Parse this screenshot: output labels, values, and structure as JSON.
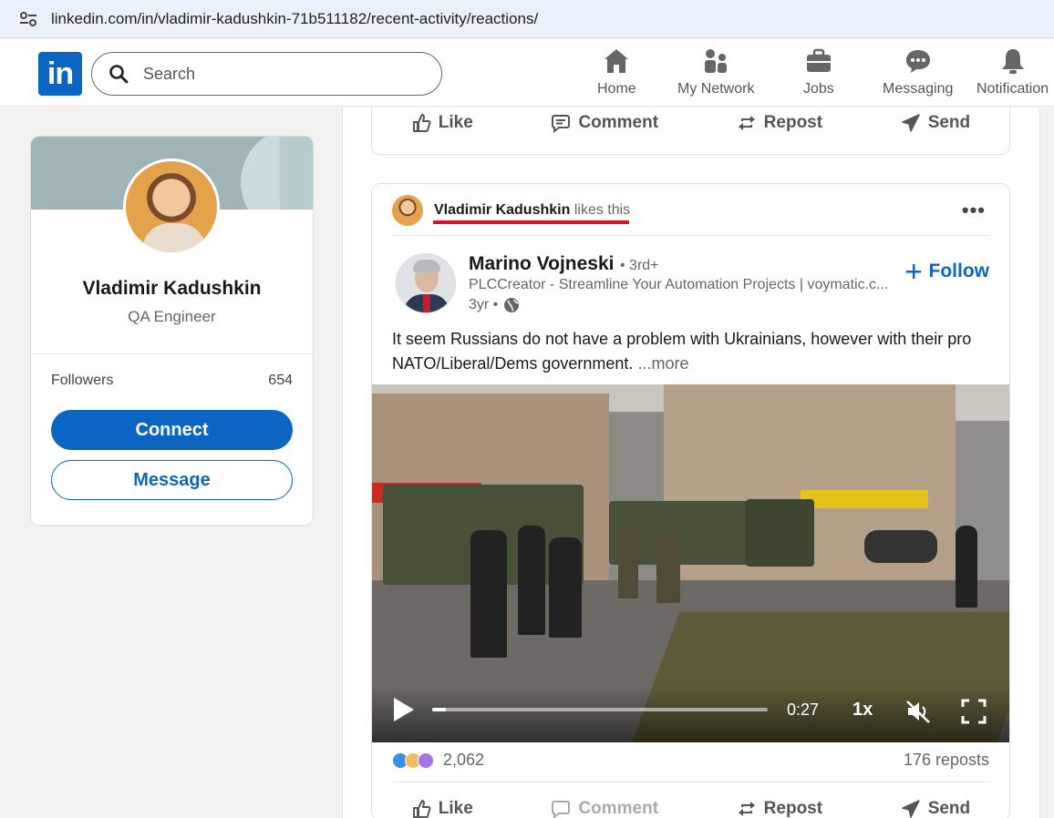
{
  "browser": {
    "url": "linkedin.com/in/vladimir-kadushkin-71b511182/recent-activity/reactions/"
  },
  "nav": {
    "logo_text": "in",
    "search_placeholder": "Search",
    "items": [
      {
        "label": "Home",
        "icon": "home-icon"
      },
      {
        "label": "My Network",
        "icon": "network-icon"
      },
      {
        "label": "Jobs",
        "icon": "briefcase-icon"
      },
      {
        "label": "Messaging",
        "icon": "chat-icon"
      },
      {
        "label": "Notification",
        "icon": "bell-icon"
      }
    ]
  },
  "profile": {
    "name": "Vladimir Kadushkin",
    "title": "QA Engineer",
    "followers_label": "Followers",
    "followers_count": "654",
    "connect_label": "Connect",
    "message_label": "Message"
  },
  "post_actions": {
    "like": "Like",
    "comment": "Comment",
    "repost": "Repost",
    "send": "Send"
  },
  "post": {
    "context_name": "Vladimir Kadushkin",
    "context_action": "likes this",
    "author_name": "Marino Vojneski",
    "author_degree": "• 3rd+",
    "author_headline": "PLCCreator - Streamline Your Automation Projects | voymatic.c...",
    "author_time": "3yr •",
    "follow_label": "Follow",
    "text": "It seem Russians do not have a problem with Ukrainians, however with their pro NATO/Liberal/Dems government.",
    "more_label": "...more",
    "video_time": "0:27",
    "video_speed": "1x",
    "video_progress": 0.04,
    "reactions_count": "2,062",
    "reposts": "176 reposts"
  },
  "colors": {
    "brand": "#0a66c2",
    "highlight_underline": "#e0121e"
  }
}
